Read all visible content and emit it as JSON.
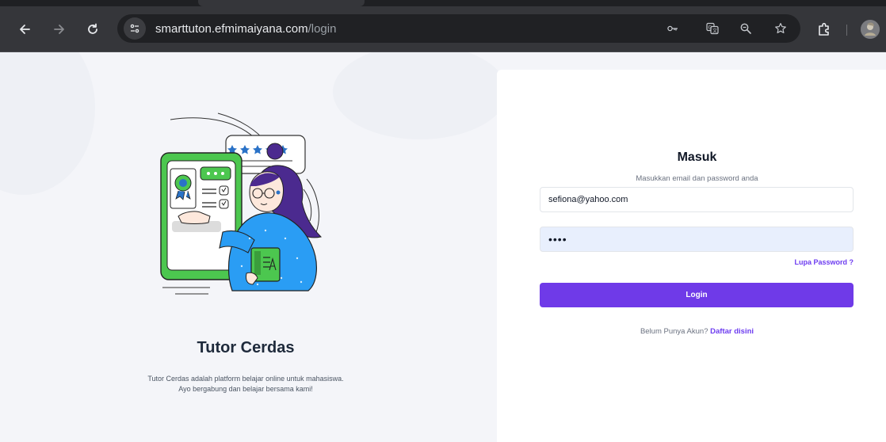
{
  "browser": {
    "url_host": "smarttuton.efmimaiyana.com",
    "url_path": "/login",
    "icons": [
      "back-icon",
      "forward-icon",
      "reload-icon",
      "site-info-icon",
      "password-key-icon",
      "translate-icon",
      "zoom-icon",
      "bookmark-star-icon",
      "extensions-icon",
      "profile-avatar"
    ]
  },
  "left": {
    "title": "Tutor Cerdas",
    "description_line1": "Tutor Cerdas adalah platform belajar online untuk mahasiswa.",
    "description_line2": "Ayo bergabung dan belajar bersama kami!"
  },
  "form": {
    "title": "Masuk",
    "subtitle": "Masukkan email dan password anda",
    "email_value": "sefiona@yahoo.com",
    "password_value": "••••",
    "forgot_label": "Lupa Password ?",
    "login_label": "Login",
    "register_prompt": "Belum Punya Akun?",
    "register_link": "Daftar disini"
  },
  "colors": {
    "accent": "#6f3ae8",
    "link": "#6d3cf0",
    "title": "#1e2a3b",
    "chrome": "#35363a"
  }
}
